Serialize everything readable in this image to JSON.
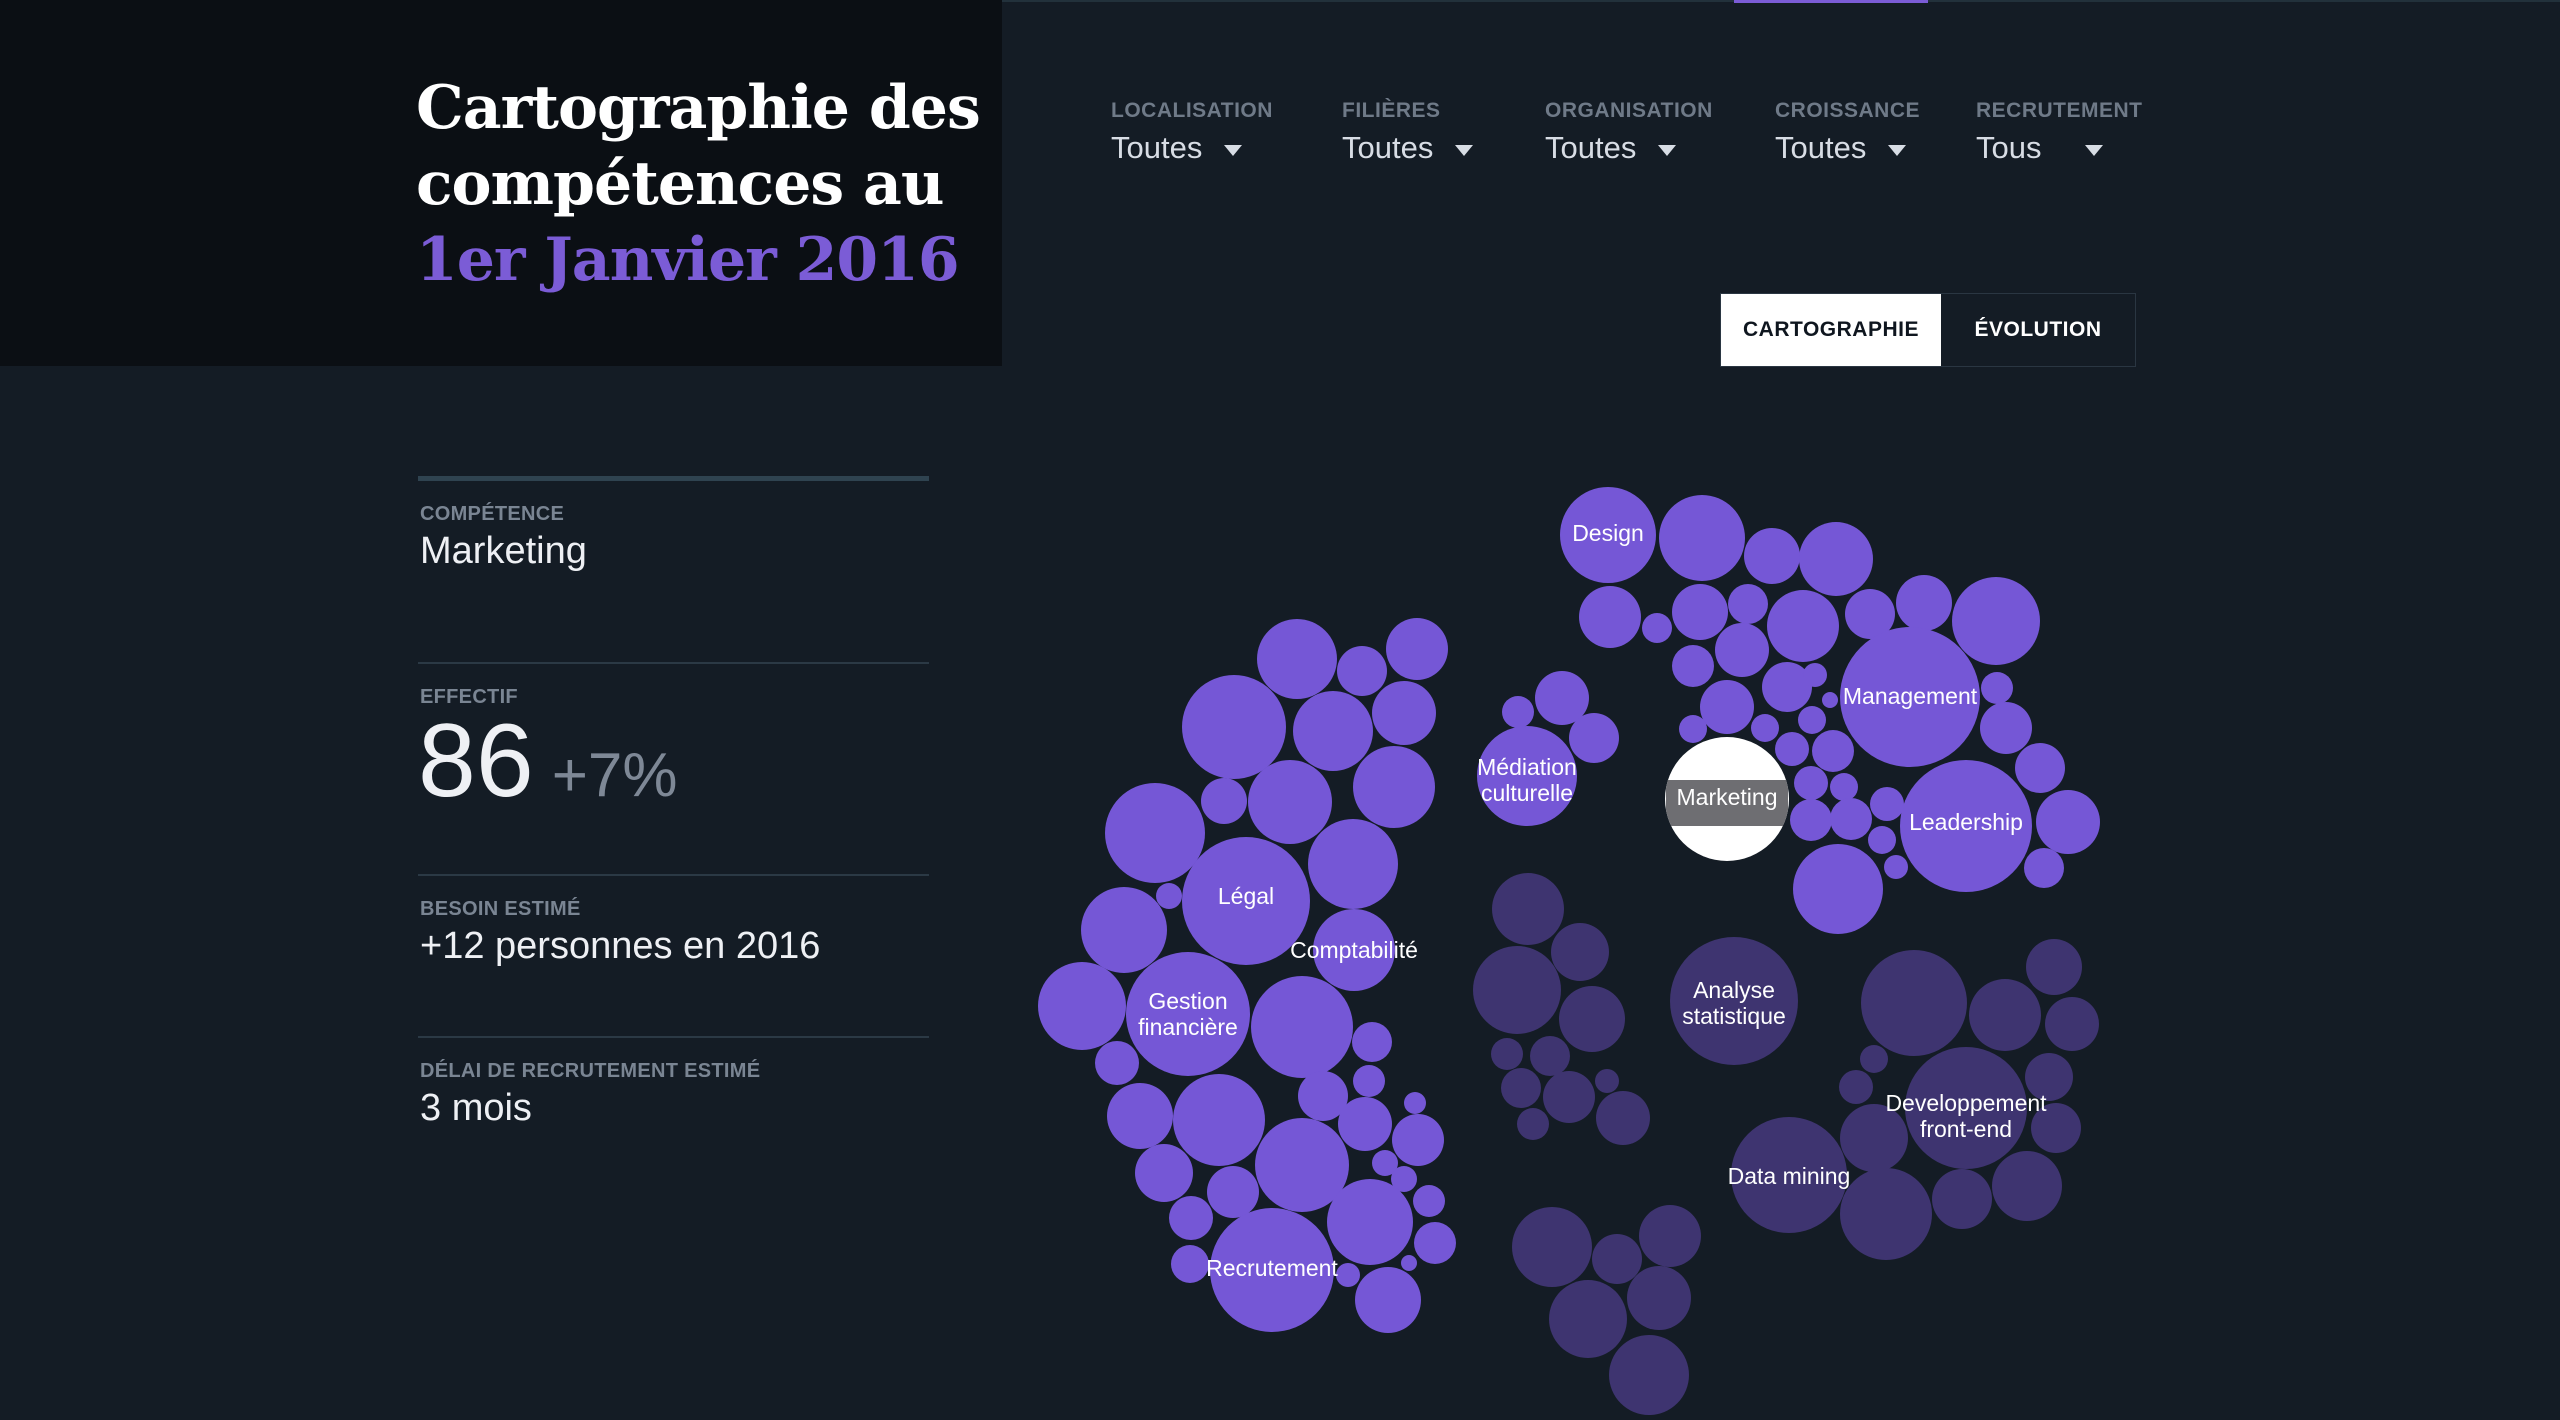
{
  "title": {
    "line1": "Cartographie des",
    "line2": "compétences au",
    "line3": "1er Janvier 2016"
  },
  "filters": [
    {
      "label": "LOCALISATION",
      "value": "Toutes"
    },
    {
      "label": "FILIÈRES",
      "value": "Toutes"
    },
    {
      "label": "ORGANISATION",
      "value": "Toutes"
    },
    {
      "label": "CROISSANCE",
      "value": "Toutes"
    },
    {
      "label": "RECRUTEMENT",
      "value": "Tous"
    }
  ],
  "view_toggle": {
    "active": "CARTOGRAPHIE",
    "inactive": "ÉVOLUTION"
  },
  "details": {
    "competence_label": "COMPÉTENCE",
    "competence_value": "Marketing",
    "effectif_label": "EFFECTIF",
    "effectif_value": "86",
    "effectif_delta": "+7%",
    "besoin_label": "BESOIN ESTIMÉ",
    "besoin_value": "+12 personnes en 2016",
    "delai_label": "DÉLAI DE RECRUTEMENT ESTIMÉ",
    "delai_value": "3 mois"
  },
  "colors": {
    "accent": "#7b5cd6",
    "bubble_bright": "#7557d6",
    "bubble_dark": "#3e3470",
    "selected": "#ffffff"
  },
  "bubble_labels": {
    "design": "Design",
    "management": "Management",
    "mediation": [
      "Médiation",
      "culturelle"
    ],
    "marketing": "Marketing",
    "leadership": "Leadership",
    "legal": "Légal",
    "comptabilite": "Comptabilité",
    "gestion": [
      "Gestion",
      "financière"
    ],
    "analyse": [
      "Analyse",
      "statistique"
    ],
    "developpement": [
      "Developpement",
      "front-end"
    ],
    "data_mining": "Data mining",
    "recrutement": "Recrutement"
  }
}
